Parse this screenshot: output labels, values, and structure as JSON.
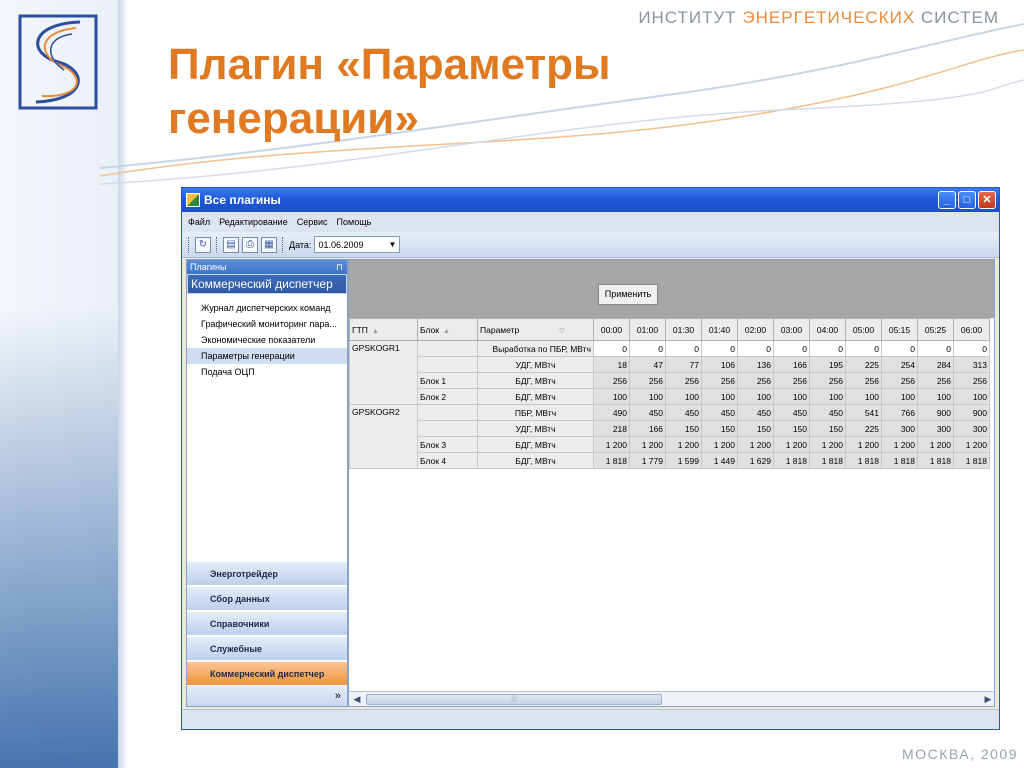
{
  "header": {
    "institute_prefix": "ИНСТИТУТ",
    "institute_name": "ЭНЕРГЕТИЧЕСКИХ",
    "institute_suffix": "СИСТЕМ"
  },
  "slide_title": "Плагин «Параметры генерации»",
  "footer": "МОСКВА, 2009",
  "window": {
    "title": "Все плагины",
    "menu": [
      "Файл",
      "Редактирование",
      "Сервис",
      "Помощь"
    ],
    "toolbar": {
      "date_label": "Дата:",
      "date_value": "01.06.2009"
    }
  },
  "sidebar": {
    "header": "Плагины",
    "group": "Коммерческий диспетчер",
    "items": [
      "Журнал диспетчерских команд",
      "Графический мониторинг пара...",
      "Экономические показатели",
      "Параметры генерации",
      "Подача ОЦП"
    ],
    "active_item": "Параметры генерации",
    "nav_buttons": [
      "Энерготрейдер",
      "Сбор данных",
      "Справочники",
      "Служебные",
      "Коммерческий диспетчер"
    ],
    "active_nav": "Коммерческий диспетчер",
    "more_glyph": "»"
  },
  "main": {
    "apply_label": "Применить",
    "columns": {
      "gtp": "ГТП",
      "block": "Блок",
      "param": "Параметр"
    },
    "times": [
      "00:00",
      "01:00",
      "01:30",
      "01:40",
      "02:00",
      "03:00",
      "04:00",
      "05:00",
      "05:15",
      "05:25",
      "06:00"
    ],
    "rows": [
      {
        "gtp": "GPSKOGR1",
        "block": "",
        "param": "Выработка по ПБР, МВтч",
        "values": [
          "0",
          "0",
          "0",
          "0",
          "0",
          "0",
          "0",
          "0",
          "0",
          "0",
          "0"
        ]
      },
      {
        "gtp": "",
        "block": "",
        "param": "УДГ, МВтч",
        "values": [
          "18",
          "47",
          "77",
          "106",
          "136",
          "166",
          "195",
          "225",
          "254",
          "284",
          "313"
        ]
      },
      {
        "gtp": "",
        "block": "Блок 1",
        "param": "БДГ, МВтч",
        "values": [
          "256",
          "256",
          "256",
          "256",
          "256",
          "256",
          "256",
          "256",
          "256",
          "256",
          "256"
        ]
      },
      {
        "gtp": "",
        "block": "Блок 2",
        "param": "БДГ, МВтч",
        "values": [
          "100",
          "100",
          "100",
          "100",
          "100",
          "100",
          "100",
          "100",
          "100",
          "100",
          "100"
        ]
      },
      {
        "gtp": "GPSKOGR2",
        "block": "",
        "param": "ПБР, МВтч",
        "values": [
          "490",
          "450",
          "450",
          "450",
          "450",
          "450",
          "450",
          "541",
          "766",
          "900",
          "900"
        ]
      },
      {
        "gtp": "",
        "block": "",
        "param": "УДГ, МВтч",
        "values": [
          "218",
          "166",
          "150",
          "150",
          "150",
          "150",
          "150",
          "225",
          "300",
          "300",
          "300"
        ]
      },
      {
        "gtp": "",
        "block": "Блок 3",
        "param": "БДГ, МВтч",
        "values": [
          "1 200",
          "1 200",
          "1 200",
          "1 200",
          "1 200",
          "1 200",
          "1 200",
          "1 200",
          "1 200",
          "1 200",
          "1 200"
        ]
      },
      {
        "gtp": "",
        "block": "Блок 4",
        "param": "БДГ, МВтч",
        "values": [
          "1 818",
          "1 779",
          "1 599",
          "1 449",
          "1 629",
          "1 818",
          "1 818",
          "1 818",
          "1 818",
          "1 818",
          "1 818"
        ]
      }
    ]
  },
  "scrollbar": {
    "thumb_glyph": "⁞⁞⁞"
  },
  "colors": {
    "accent_orange": "#e07a22",
    "window_blue": "#1f5ad8",
    "sidebar_blue": "#2f5aa3"
  }
}
